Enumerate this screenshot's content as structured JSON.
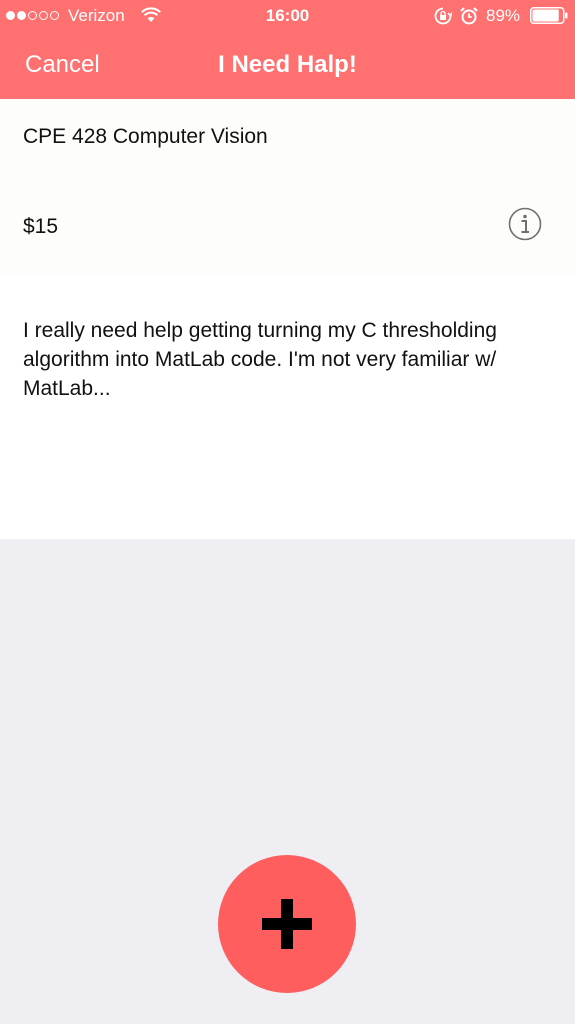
{
  "status_bar": {
    "carrier": "Verizon",
    "signal_bars_filled": 2,
    "signal_bars_total": 5,
    "time": "16:00",
    "battery_percent": "89%",
    "battery_level": 0.89,
    "icons": [
      "wifi-icon",
      "rotation-lock-icon",
      "alarm-icon",
      "battery-icon"
    ]
  },
  "nav": {
    "cancel_label": "Cancel",
    "title": "I Need Halp!"
  },
  "form": {
    "course": "CPE 428 Computer Vision",
    "price": "$15",
    "description": "I really need help getting turning my C thresholding algorithm into MatLab code. I'm not very familiar w/ MatLab..."
  },
  "fab": {
    "icon": "plus-icon"
  },
  "colors": {
    "header": "#ff7070",
    "fab": "#ff5e5e",
    "background": "#efeef3"
  }
}
